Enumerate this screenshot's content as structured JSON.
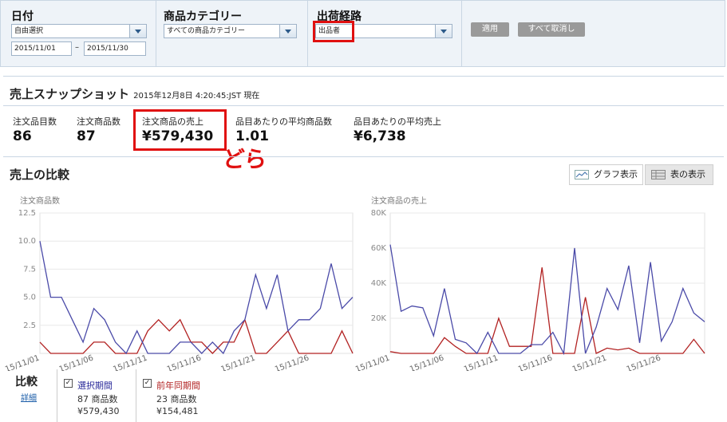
{
  "filters": {
    "date_label": "日付",
    "date_select": "自由選択",
    "date_from": "2015/11/01",
    "date_sep": "–",
    "date_to": "2015/11/30",
    "category_label": "商品カテゴリー",
    "category_select": "すべての商品カテゴリー",
    "channel_label": "出荷経路",
    "channel_select": "出品者",
    "apply_label": "適用",
    "cancel_label": "すべて取消し"
  },
  "snapshot": {
    "title": "売上スナップショット",
    "timestamp": "2015年12月8日 4:20:45:JST 現在",
    "metrics": [
      {
        "label": "注文品目数",
        "value": "86"
      },
      {
        "label": "注文商品数",
        "value": "87"
      },
      {
        "label": "注文商品の売上",
        "value": "¥579,430"
      },
      {
        "label": "品目あたりの平均商品数",
        "value": "1.01"
      },
      {
        "label": "品目あたりの平均売上",
        "value": "¥6,738"
      }
    ],
    "annotation": "どら"
  },
  "comparison": {
    "title": "売上の比較",
    "graph_view_label": "グラフ表示",
    "table_view_label": "表の表示"
  },
  "chart_data": [
    {
      "type": "line",
      "title": "注文商品数",
      "x": [
        "15/11/01",
        "15/11/02",
        "15/11/03",
        "15/11/04",
        "15/11/05",
        "15/11/06",
        "15/11/07",
        "15/11/08",
        "15/11/09",
        "15/11/10",
        "15/11/11",
        "15/11/12",
        "15/11/13",
        "15/11/14",
        "15/11/15",
        "15/11/16",
        "15/11/17",
        "15/11/18",
        "15/11/19",
        "15/11/20",
        "15/11/21",
        "15/11/22",
        "15/11/23",
        "15/11/24",
        "15/11/25",
        "15/11/26",
        "15/11/27",
        "15/11/28",
        "15/11/29",
        "15/11/30"
      ],
      "x_tick_labels": [
        "15/11/01",
        "15/11/06",
        "15/11/11",
        "15/11/16",
        "15/11/21",
        "15/11/26"
      ],
      "y_ticks": [
        "2.5",
        "5.0",
        "7.5",
        "10.0",
        "12.5"
      ],
      "ylim": [
        0,
        12.5
      ],
      "series": [
        {
          "name": "選択期間",
          "color": "#4a4aa8",
          "values": [
            10,
            5,
            5,
            3,
            1,
            4,
            3,
            1,
            0,
            2,
            0,
            0,
            0,
            1,
            1,
            0,
            1,
            0,
            2,
            3,
            7,
            4,
            7,
            2,
            3,
            3,
            4,
            8,
            4,
            5
          ]
        },
        {
          "name": "前年同期間",
          "color": "#b22222",
          "values": [
            1,
            0,
            0,
            0,
            0,
            1,
            1,
            0,
            0,
            0,
            2,
            3,
            2,
            3,
            1,
            1,
            0,
            1,
            1,
            3,
            0,
            0,
            1,
            2,
            0,
            0,
            0,
            0,
            2,
            0
          ]
        }
      ]
    },
    {
      "type": "line",
      "title": "注文商品の売上",
      "x": [
        "15/11/01",
        "15/11/02",
        "15/11/03",
        "15/11/04",
        "15/11/05",
        "15/11/06",
        "15/11/07",
        "15/11/08",
        "15/11/09",
        "15/11/10",
        "15/11/11",
        "15/11/12",
        "15/11/13",
        "15/11/14",
        "15/11/15",
        "15/11/16",
        "15/11/17",
        "15/11/18",
        "15/11/19",
        "15/11/20",
        "15/11/21",
        "15/11/22",
        "15/11/23",
        "15/11/24",
        "15/11/25",
        "15/11/26",
        "15/11/27",
        "15/11/28",
        "15/11/29",
        "15/11/30"
      ],
      "x_tick_labels": [
        "15/11/01",
        "15/11/06",
        "15/11/11",
        "15/11/16",
        "15/11/21",
        "15/11/26"
      ],
      "y_ticks": [
        "20K",
        "40K",
        "60K",
        "80K"
      ],
      "ylim": [
        0,
        80000
      ],
      "series": [
        {
          "name": "選択期間",
          "color": "#4a4aa8",
          "values": [
            62000,
            24000,
            27000,
            26000,
            10000,
            37000,
            8000,
            6000,
            0,
            12000,
            0,
            0,
            0,
            5000,
            5000,
            12000,
            0,
            60000,
            0,
            15000,
            37000,
            25000,
            50000,
            6000,
            52000,
            7000,
            18000,
            37000,
            23000,
            18000
          ]
        },
        {
          "name": "前年同期間",
          "color": "#b22222",
          "values": [
            1000,
            0,
            0,
            0,
            0,
            9000,
            4000,
            0,
            0,
            0,
            20000,
            4000,
            4000,
            4000,
            49000,
            0,
            0,
            0,
            32000,
            0,
            3000,
            2000,
            3000,
            0,
            0,
            0,
            0,
            0,
            8000,
            0
          ]
        }
      ]
    }
  ],
  "legend": {
    "title": "比較",
    "details_link": "詳細",
    "current": {
      "check": "✓",
      "name": "選択期間",
      "units": "87 商品数",
      "sales": "¥579,430",
      "color": "#2a2a9a"
    },
    "previous": {
      "check": "✓",
      "name": "前年同期間",
      "units": "23 商品数",
      "sales": "¥154,481",
      "color": "#b22222"
    }
  }
}
